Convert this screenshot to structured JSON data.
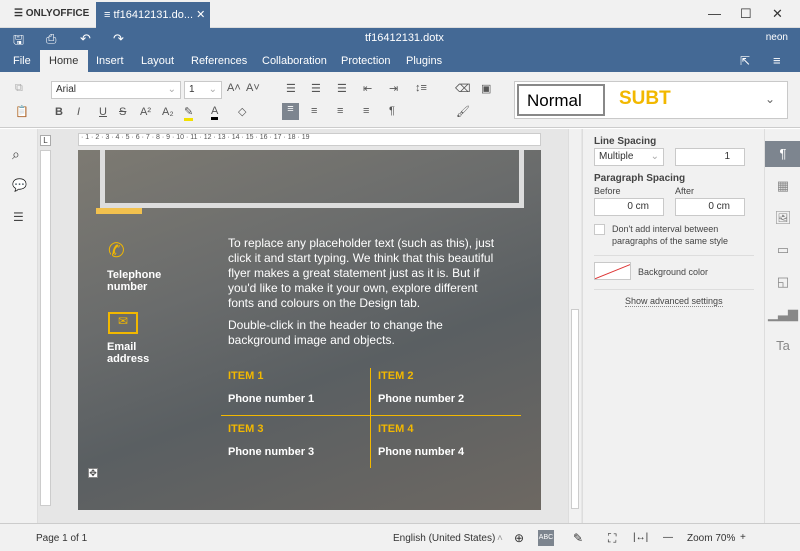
{
  "app": {
    "logo": "ONLYOFFICE",
    "tab": "tf16412131.do...",
    "doc_title": "tf16412131.dotx",
    "user": "neon"
  },
  "menu": [
    "File",
    "Home",
    "Insert",
    "Layout",
    "References",
    "Collaboration",
    "Protection",
    "Plugins"
  ],
  "toolbar": {
    "font": "Arial",
    "size": "1",
    "style_normal": "Normal",
    "style_subt": "SUBT"
  },
  "page": {
    "telephone": "Telephone number",
    "email": "Email address",
    "para1": "To replace any placeholder text (such as this), just click it and start typing. We think that this beautiful flyer makes a great statement just as it is. But if you'd like to make it your own, explore different fonts and colours on the Design tab.",
    "para2": "Double-click in the header to change the background image and objects.",
    "items": [
      {
        "title": "ITEM 1",
        "phone": "Phone number 1"
      },
      {
        "title": "ITEM 2",
        "phone": "Phone number 2"
      },
      {
        "title": "ITEM 3",
        "phone": "Phone number 3"
      },
      {
        "title": "ITEM 4",
        "phone": "Phone number 4"
      }
    ]
  },
  "panel": {
    "line_spacing": "Line Spacing",
    "ls_type": "Multiple",
    "ls_value": "1",
    "para_spacing": "Paragraph Spacing",
    "before": "Before",
    "after": "After",
    "before_val": "0 cm",
    "after_val": "0 cm",
    "checkbox": "Don't add interval between paragraphs of the same style",
    "bg_color": "Background color",
    "advanced": "Show advanced settings"
  },
  "status": {
    "page": "Page 1 of 1",
    "language": "English (United States)",
    "zoom": "Zoom 70%"
  },
  "colors": {
    "header": "#446995",
    "accent": "#f2b800"
  }
}
